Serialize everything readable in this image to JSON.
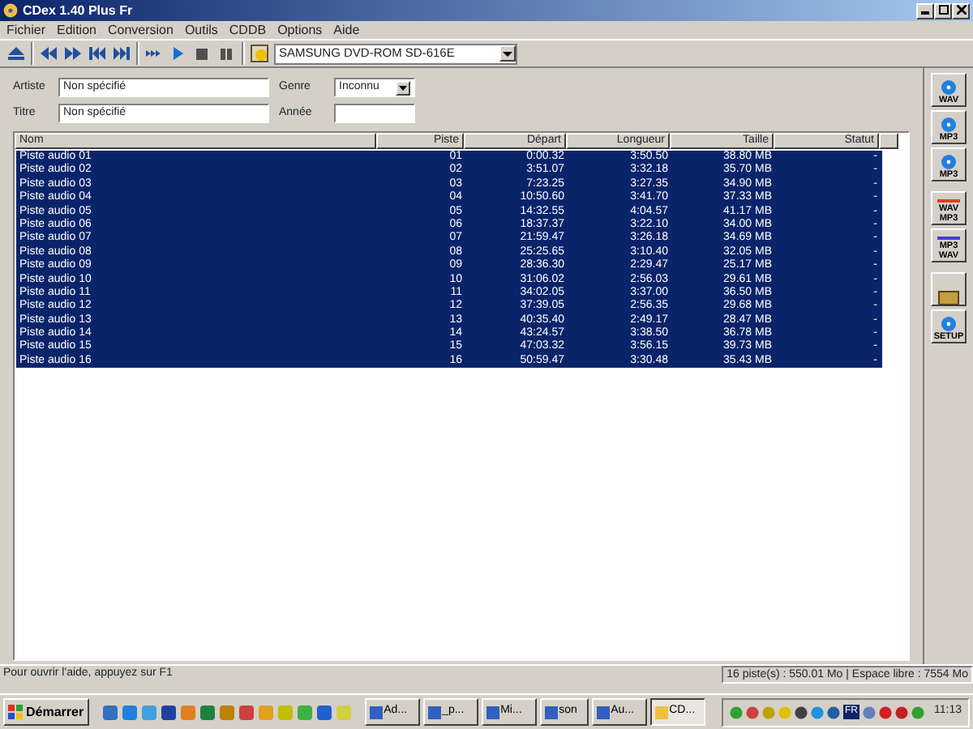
{
  "window": {
    "title": "CDex 1.40 Plus Fr"
  },
  "menu": [
    "Fichier",
    "Edition",
    "Conversion",
    "Outils",
    "CDDB",
    "Options",
    "Aide"
  ],
  "drive": {
    "value": "SAMSUNG DVD-ROM SD-616E"
  },
  "form": {
    "artist": {
      "label": "Artiste",
      "value": "Non spécifié"
    },
    "title": {
      "label": "Titre",
      "value": "Non spécifié"
    },
    "genre": {
      "label": "Genre",
      "value": "Inconnu"
    },
    "year": {
      "label": "Année"
    }
  },
  "table": {
    "columns": [
      "Nom",
      "Piste",
      "Départ",
      "Longueur",
      "Taille",
      "Statut"
    ],
    "rows": [
      {
        "cells": [
          "Piste audio 01",
          "01",
          "0:00.32",
          "3:50.50",
          "38.80 MB",
          "-"
        ],
        "selected": true
      },
      {
        "cells": [
          "Piste audio 02",
          "02",
          "3:51.07",
          "3:32.18",
          "35.70 MB",
          "-"
        ],
        "selected": true
      },
      {
        "cells": [
          "Piste audio 03",
          "03",
          "7:23.25",
          "3:27.35",
          "34.90 MB",
          "-"
        ],
        "selected": true
      },
      {
        "cells": [
          "Piste audio 04",
          "04",
          "10:50.60",
          "3:41.70",
          "37.33 MB",
          "-"
        ],
        "selected": true
      },
      {
        "cells": [
          "Piste audio 05",
          "05",
          "14:32.55",
          "4:04.57",
          "41.17 MB",
          "-"
        ],
        "selected": true
      },
      {
        "cells": [
          "Piste audio 06",
          "06",
          "18:37.37",
          "3:22.10",
          "34.00 MB",
          "-"
        ],
        "selected": true
      },
      {
        "cells": [
          "Piste audio 07",
          "07",
          "21:59.47",
          "3:26.18",
          "34.69 MB",
          "-"
        ],
        "selected": true
      },
      {
        "cells": [
          "Piste audio 08",
          "08",
          "25:25.65",
          "3:10.40",
          "32.05 MB",
          "-"
        ],
        "selected": true
      },
      {
        "cells": [
          "Piste audio 09",
          "09",
          "28:36.30",
          "2:29.47",
          "25.17 MB",
          "-"
        ],
        "selected": true
      },
      {
        "cells": [
          "Piste audio 10",
          "10",
          "31:06.02",
          "2:56.03",
          "29.61 MB",
          "-"
        ],
        "selected": true
      },
      {
        "cells": [
          "Piste audio 11",
          "11",
          "34:02.05",
          "3:37.00",
          "36.50 MB",
          "-"
        ],
        "selected": true
      },
      {
        "cells": [
          "Piste audio 12",
          "12",
          "37:39.05",
          "2:56.35",
          "29.68 MB",
          "-"
        ],
        "selected": true
      },
      {
        "cells": [
          "Piste audio 13",
          "13",
          "40:35.40",
          "2:49.17",
          "28.47 MB",
          "-"
        ],
        "selected": true
      },
      {
        "cells": [
          "Piste audio 14",
          "14",
          "43:24.57",
          "3:38.50",
          "36.78 MB",
          "-"
        ],
        "selected": true
      },
      {
        "cells": [
          "Piste audio 15",
          "15",
          "47:03.32",
          "3:56.15",
          "39.73 MB",
          "-"
        ],
        "selected": true
      },
      {
        "cells": [
          "Piste audio 16",
          "16",
          "50:59.47",
          "3:30.48",
          "35.43 MB",
          "-"
        ],
        "selected": true
      }
    ]
  },
  "side_buttons": [
    {
      "kind": "disc",
      "labels": [
        "WAV"
      ]
    },
    {
      "kind": "disc",
      "labels": [
        "MP3"
      ]
    },
    {
      "kind": "disc",
      "labels": [
        "MP3"
      ]
    },
    {
      "kind": "convert",
      "labels": [
        "WAV",
        "MP3"
      ]
    },
    {
      "kind": "convert",
      "labels": [
        "MP3",
        "WAV"
      ]
    },
    {
      "kind": "database"
    },
    {
      "kind": "disc",
      "labels": [
        "SETUP"
      ]
    }
  ],
  "status_bar": {
    "help": "Pour ouvrir l'aide, appuyez sur F1",
    "summary": "16 piste(s) : 550.01 Mo | Espace libre :  7554 Mo"
  },
  "taskbar": {
    "start": "Démarrer",
    "tasks": [
      {
        "label": "Ad...",
        "selected": false
      },
      {
        "label": "_p...",
        "selected": false
      },
      {
        "label": "Mi...",
        "selected": false
      },
      {
        "label": "son",
        "selected": false
      },
      {
        "label": "Au...",
        "selected": false
      },
      {
        "label": "CD...",
        "selected": true
      }
    ],
    "language": "FR",
    "clock": "11:13"
  }
}
